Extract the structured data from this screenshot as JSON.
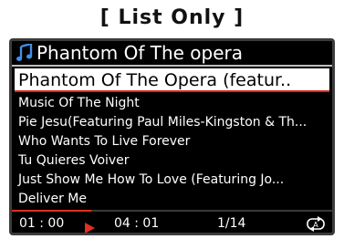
{
  "caption": "[ List Only ]",
  "header": {
    "title": "Phantom Of The opera",
    "icon": "music-note-icon",
    "icon_color": "#3f8fe8"
  },
  "tracks": [
    {
      "label": "Phantom Of The Opera (featur..",
      "selected": true
    },
    {
      "label": "Music Of The Night"
    },
    {
      "label": "Pie Jesu(Featuring Paul Miles-Kingston & Th..."
    },
    {
      "label": "Who Wants To Live Forever"
    },
    {
      "label": "Tu Quieres Voiver"
    },
    {
      "label": "Just Show Me How To Love (Featuring Jo..."
    },
    {
      "label": "Deliver Me"
    }
  ],
  "status": {
    "elapsed": "01 : 00",
    "duration": "04 : 01",
    "track_counter": "1/14",
    "progress": 0.249,
    "play_icon": "play-icon",
    "repeat_icon": "repeat-one-icon",
    "accent_color": "#e0301e"
  }
}
